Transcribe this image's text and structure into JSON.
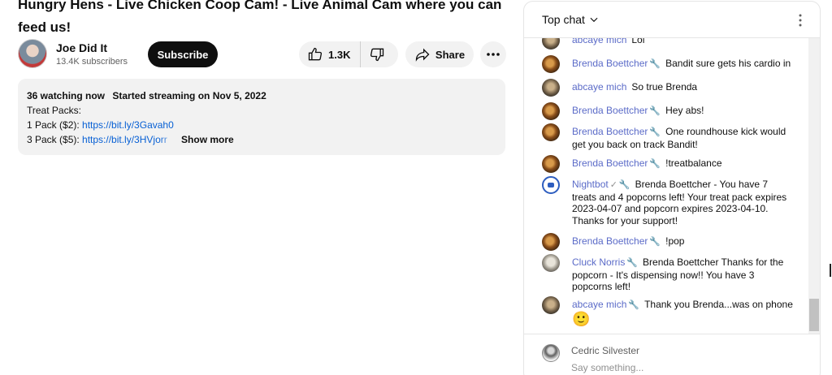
{
  "video": {
    "title": "Hungry Hens - Live Chicken Coop Cam! - Live Animal Cam where you can feed us!"
  },
  "owner": {
    "channel_name": "Joe Did It",
    "subscribers": "13.4K subscribers",
    "subscribe_label": "Subscribe"
  },
  "actions": {
    "like_count": "1.3K",
    "share_label": "Share"
  },
  "description": {
    "watching": "36 watching now",
    "started": "Started streaming on Nov 5, 2022",
    "line1": "Treat Packs:",
    "line2_prefix": "1 Pack ($2): ",
    "line2_link": "https://bit.ly/3Gavah0",
    "line3_prefix": "3 Pack ($5): ",
    "line3_link": "https://bit.ly/3HVjorr",
    "show_more": "Show more"
  },
  "chat": {
    "mode_label": "Top chat",
    "messages": [
      {
        "author": "abcaye mich",
        "text": "Lol"
      },
      {
        "author": "Brenda Boettcher",
        "text": "Bandit sure gets his cardio in"
      },
      {
        "author": "abcaye mich",
        "text": "So true Brenda"
      },
      {
        "author": "Brenda Boettcher",
        "text": "Hey abs!"
      },
      {
        "author": "Brenda Boettcher",
        "text": "One roundhouse kick would get you back on track Bandit!"
      },
      {
        "author": "Brenda Boettcher",
        "text": "!treatbalance"
      },
      {
        "author": "Nightbot",
        "text": "Brenda Boettcher - You have 7 treats and 4 popcorns left! Your treat pack expires 2023-04-07 and popcorn expires 2023-04-10. Thanks for your support!"
      },
      {
        "author": "Brenda Boettcher",
        "text": "!pop"
      },
      {
        "author": "Cluck Norris",
        "text": "Brenda Boettcher Thanks for the popcorn - It's dispensing now!! You have 3 popcorns left!"
      },
      {
        "author": "abcaye mich",
        "text": "Thank you Brenda...was on phone",
        "emoji": "🙂"
      }
    ],
    "current_user": "Cedric Silvester",
    "input_placeholder": "Say something..."
  },
  "colors": {
    "author": "#5b6bc8",
    "link": "#065fd4",
    "subscribe_bg": "#0f0f0f"
  }
}
